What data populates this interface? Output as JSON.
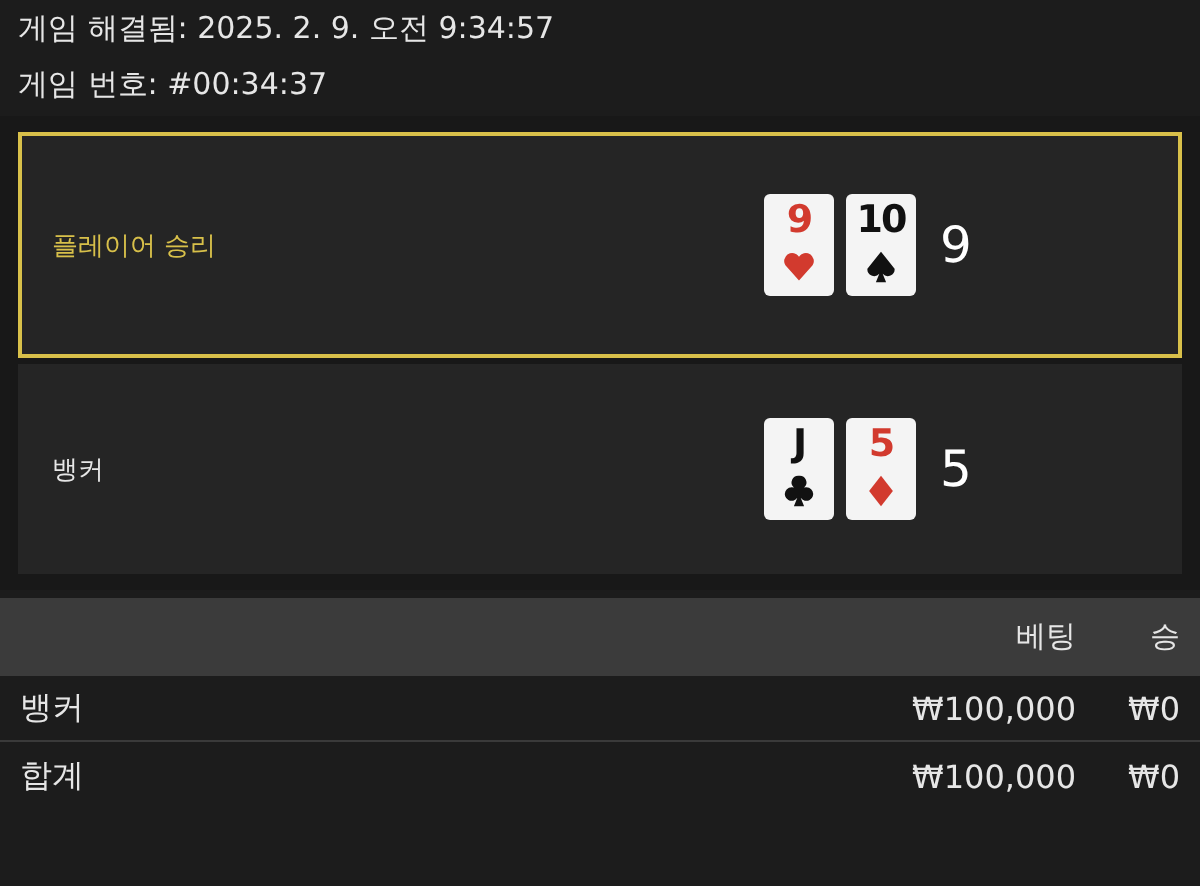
{
  "header": {
    "resolved": "게임 해결됨: 2025. 2. 9. 오전 9:34:57",
    "game_number": "게임 번호: #00:34:37"
  },
  "hands": [
    {
      "label": "플레이어 승리",
      "winner": true,
      "cards": [
        {
          "rank": "9",
          "kind": "hearts"
        },
        {
          "rank": "10",
          "kind": "spades"
        }
      ],
      "total": "9"
    },
    {
      "label": "뱅커",
      "winner": false,
      "cards": [
        {
          "rank": "J",
          "kind": "clubs"
        },
        {
          "rank": "5",
          "kind": "diamonds"
        }
      ],
      "total": "5"
    }
  ],
  "bets_table": {
    "columns": [
      "베팅",
      "승"
    ],
    "rows": [
      {
        "label": "뱅커",
        "bet": "₩100,000",
        "win": "₩0"
      },
      {
        "label": "합계",
        "bet": "₩100,000",
        "win": "₩0"
      }
    ]
  }
}
